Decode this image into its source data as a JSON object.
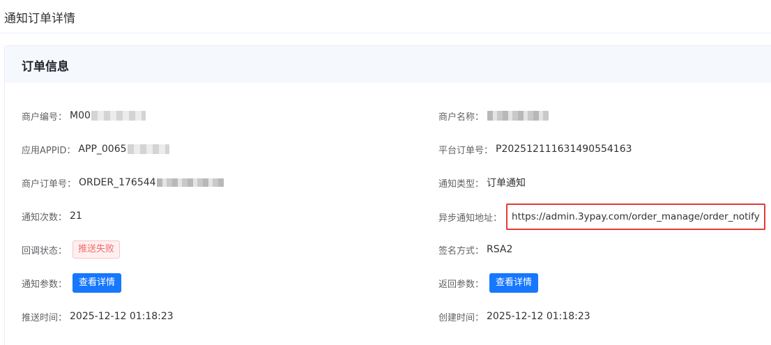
{
  "page": {
    "title": "通知订单详情"
  },
  "card": {
    "title": "订单信息"
  },
  "fields": {
    "merchant_no": {
      "label": "商户编号：",
      "value": "M00"
    },
    "merchant_name": {
      "label": "商户名称：",
      "value": ""
    },
    "app_id": {
      "label": "应用APPID：",
      "value": "APP_0065"
    },
    "platform_order": {
      "label": "平台订单号：",
      "value": "P202512111631490554163"
    },
    "merchant_order": {
      "label": "商户订单号：",
      "value": "ORDER_176544"
    },
    "notify_type": {
      "label": "通知类型：",
      "value": "订单通知"
    },
    "notify_count": {
      "label": "通知次数：",
      "value": "21"
    },
    "notify_url": {
      "label": "异步通知地址：",
      "value": "https://admin.3ypay.com/order_manage/order_notify"
    },
    "callback_status": {
      "label": "回调状态：",
      "value": "推送失败"
    },
    "sign_method": {
      "label": "签名方式：",
      "value": "RSA2"
    },
    "notify_params": {
      "label": "通知参数：",
      "button": "查看详情"
    },
    "return_params": {
      "label": "返回参数：",
      "button": "查看详情"
    },
    "push_time": {
      "label": "推送时间：",
      "value": "2025-12-12 01:18:23"
    },
    "create_time": {
      "label": "创建时间：",
      "value": "2025-12-12 01:18:23"
    }
  },
  "colors": {
    "primary": "#1677ff",
    "danger": "#f56c6c",
    "highlight_border": "#e53935",
    "card_header_bg": "#f5f9fd"
  }
}
